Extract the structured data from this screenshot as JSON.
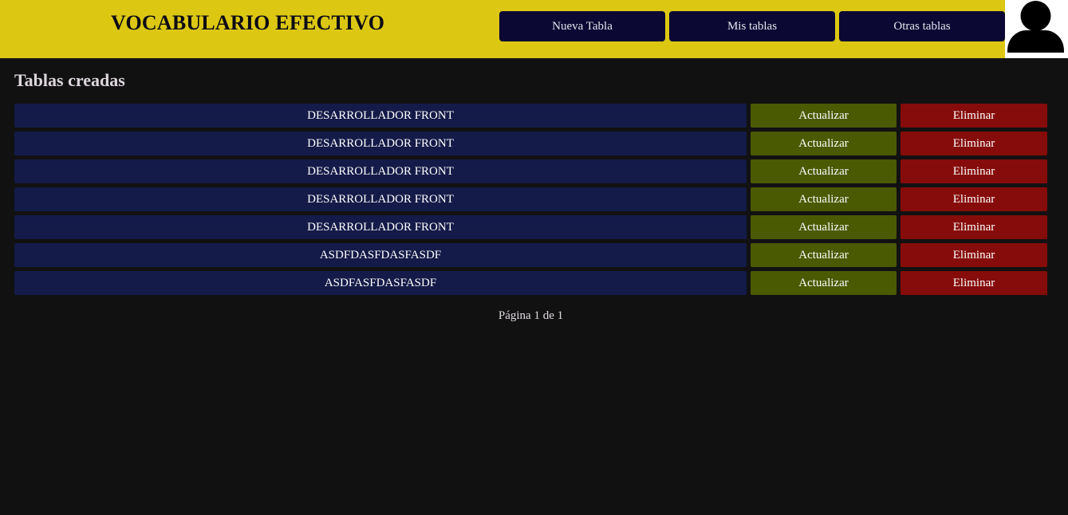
{
  "header": {
    "brand": "VOCABULARIO EFECTIVO",
    "nav": [
      {
        "label": "Nueva Tabla"
      },
      {
        "label": "Mis tablas"
      },
      {
        "label": "Otras tablas"
      }
    ],
    "avatar_icon": "user-icon"
  },
  "main": {
    "title": "Tablas creadas",
    "rows": [
      {
        "name": "DESARROLLADOR FRONT",
        "update_label": "Actualizar",
        "delete_label": "Eliminar"
      },
      {
        "name": "DESARROLLADOR FRONT",
        "update_label": "Actualizar",
        "delete_label": "Eliminar"
      },
      {
        "name": "DESARROLLADOR FRONT",
        "update_label": "Actualizar",
        "delete_label": "Eliminar"
      },
      {
        "name": "DESARROLLADOR FRONT",
        "update_label": "Actualizar",
        "delete_label": "Eliminar"
      },
      {
        "name": "DESARROLLADOR FRONT",
        "update_label": "Actualizar",
        "delete_label": "Eliminar"
      },
      {
        "name": "ASDFDASFDASFASDF",
        "update_label": "Actualizar",
        "delete_label": "Eliminar"
      },
      {
        "name": "ASDFASFDASFASDF",
        "update_label": "Actualizar",
        "delete_label": "Eliminar"
      }
    ],
    "pagination": "Página 1 de 1"
  },
  "colors": {
    "header_bg": "#dcc712",
    "nav_bg": "#0b0833",
    "row_bg": "#141b48",
    "update_bg": "#4a5a03",
    "delete_bg": "#850c0a",
    "page_bg": "#121112"
  }
}
